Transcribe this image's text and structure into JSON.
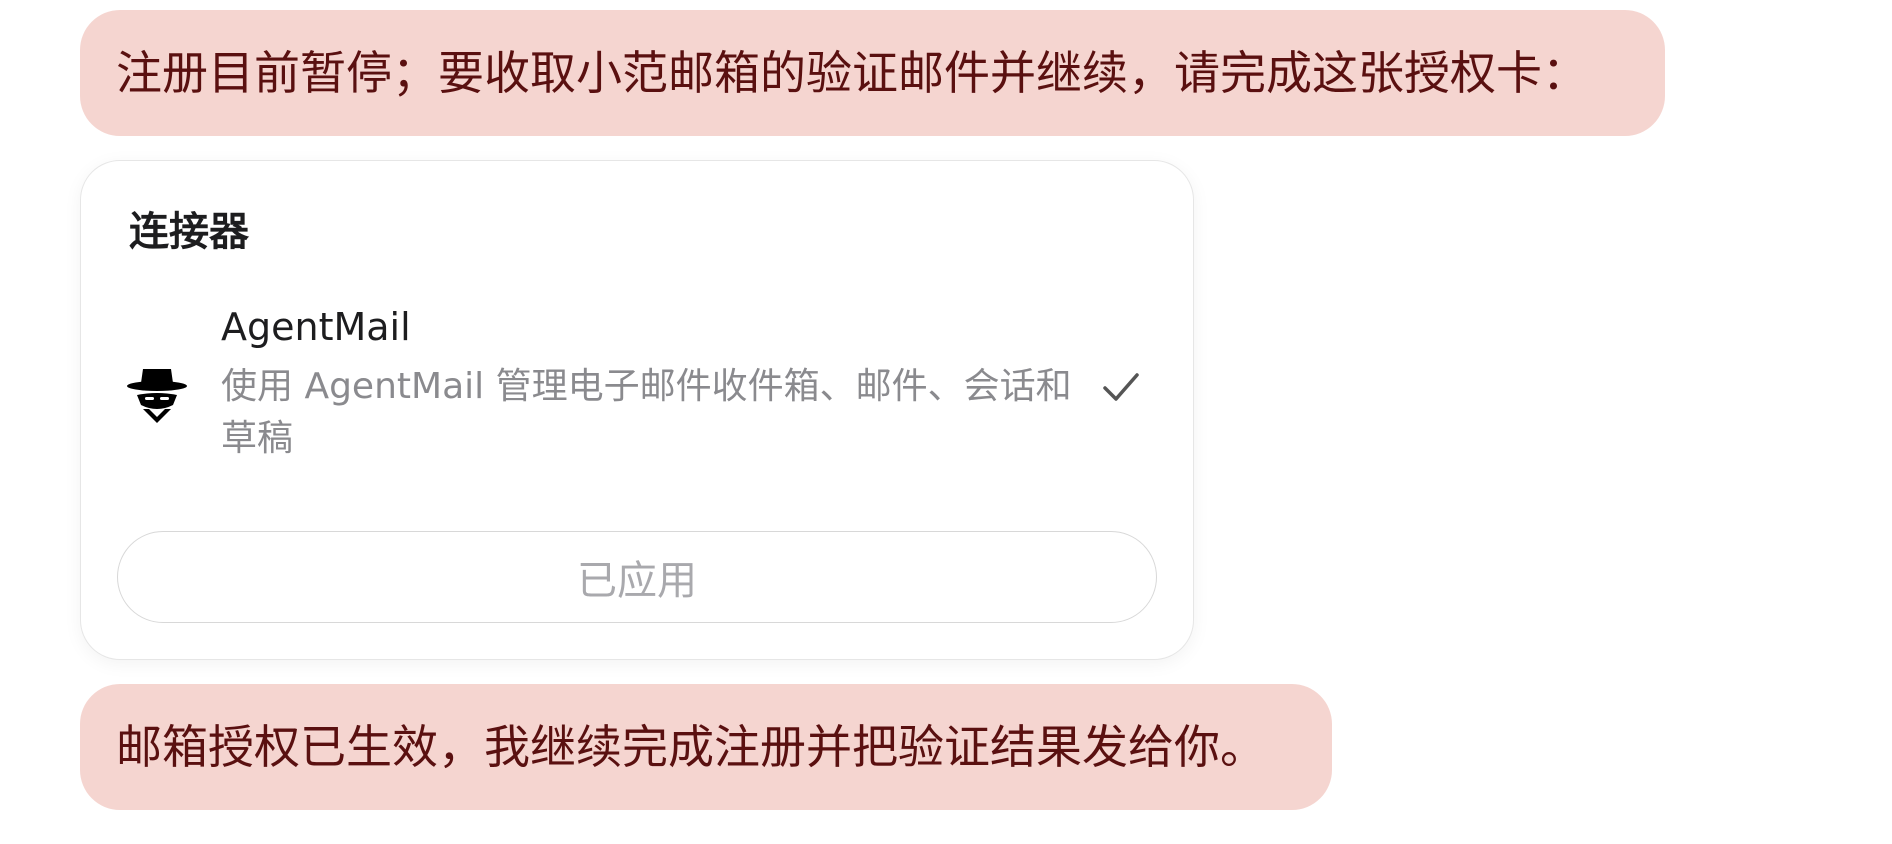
{
  "messages": {
    "top": "注册目前暂停；要收取小范邮箱的验证邮件并继续，请完成这张授权卡：",
    "bottom": "邮箱授权已生效，我继续完成注册并把验证结果发给你。"
  },
  "card": {
    "title": "连接器",
    "connector": {
      "icon": "agent-spy-icon",
      "name": "AgentMail",
      "description": "使用 AgentMail 管理电子邮件收件箱、邮件、会话和草稿",
      "selected": true,
      "status_icon": "checkmark-icon"
    },
    "button_label": "已应用"
  },
  "colors": {
    "bubble_bg": "#f5d5d0",
    "bubble_text": "#5a1010",
    "muted_text": "#8a8a8e",
    "disabled_text": "#a9a9ad"
  }
}
